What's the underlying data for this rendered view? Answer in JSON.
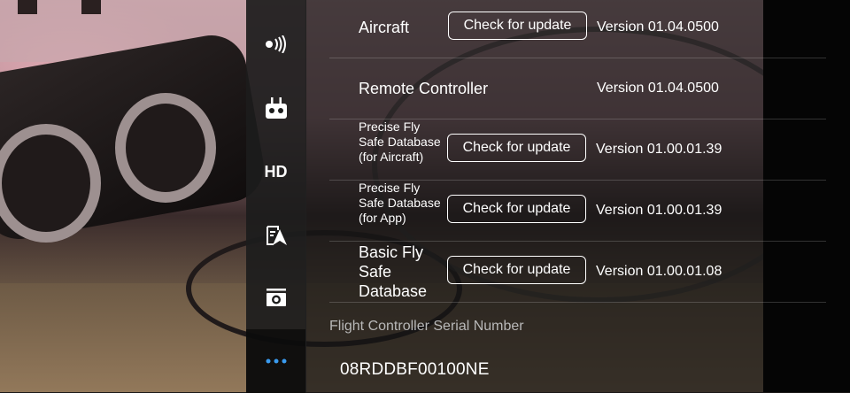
{
  "sidebar": {
    "items": [
      {
        "icon": "wifi-signal-icon",
        "glyph": "●)))"
      },
      {
        "icon": "remote-controller-icon",
        "glyph": "▣"
      },
      {
        "icon": "hd-icon",
        "glyph": "HD"
      },
      {
        "icon": "checklist-airplane-icon",
        "glyph": "⚡"
      },
      {
        "icon": "camera-icon",
        "glyph": "◉"
      },
      {
        "icon": "more-icon",
        "glyph": "•••"
      }
    ],
    "active_index": 5
  },
  "rows": [
    {
      "label": "Aircraft",
      "button": "Check for update",
      "version": "Version 01.04.0500"
    },
    {
      "label": "Remote Controller",
      "version": "Version 01.04.0500"
    },
    {
      "label": "Precise Fly Safe Database (for Aircraft)",
      "button": "Check for update",
      "version": "Version 01.00.01.39"
    },
    {
      "label": "Precise Fly Safe Database (for App)",
      "button": "Check for update",
      "version": "Version 01.00.01.39"
    },
    {
      "label": "Basic Fly Safe Database",
      "button": "Check for update",
      "version": "Version 01.00.01.08"
    }
  ],
  "serial": {
    "title": "Flight Controller Serial Number",
    "value": "08RDDBF00100NE"
  },
  "colors": {
    "accent": "#3a9bef"
  }
}
